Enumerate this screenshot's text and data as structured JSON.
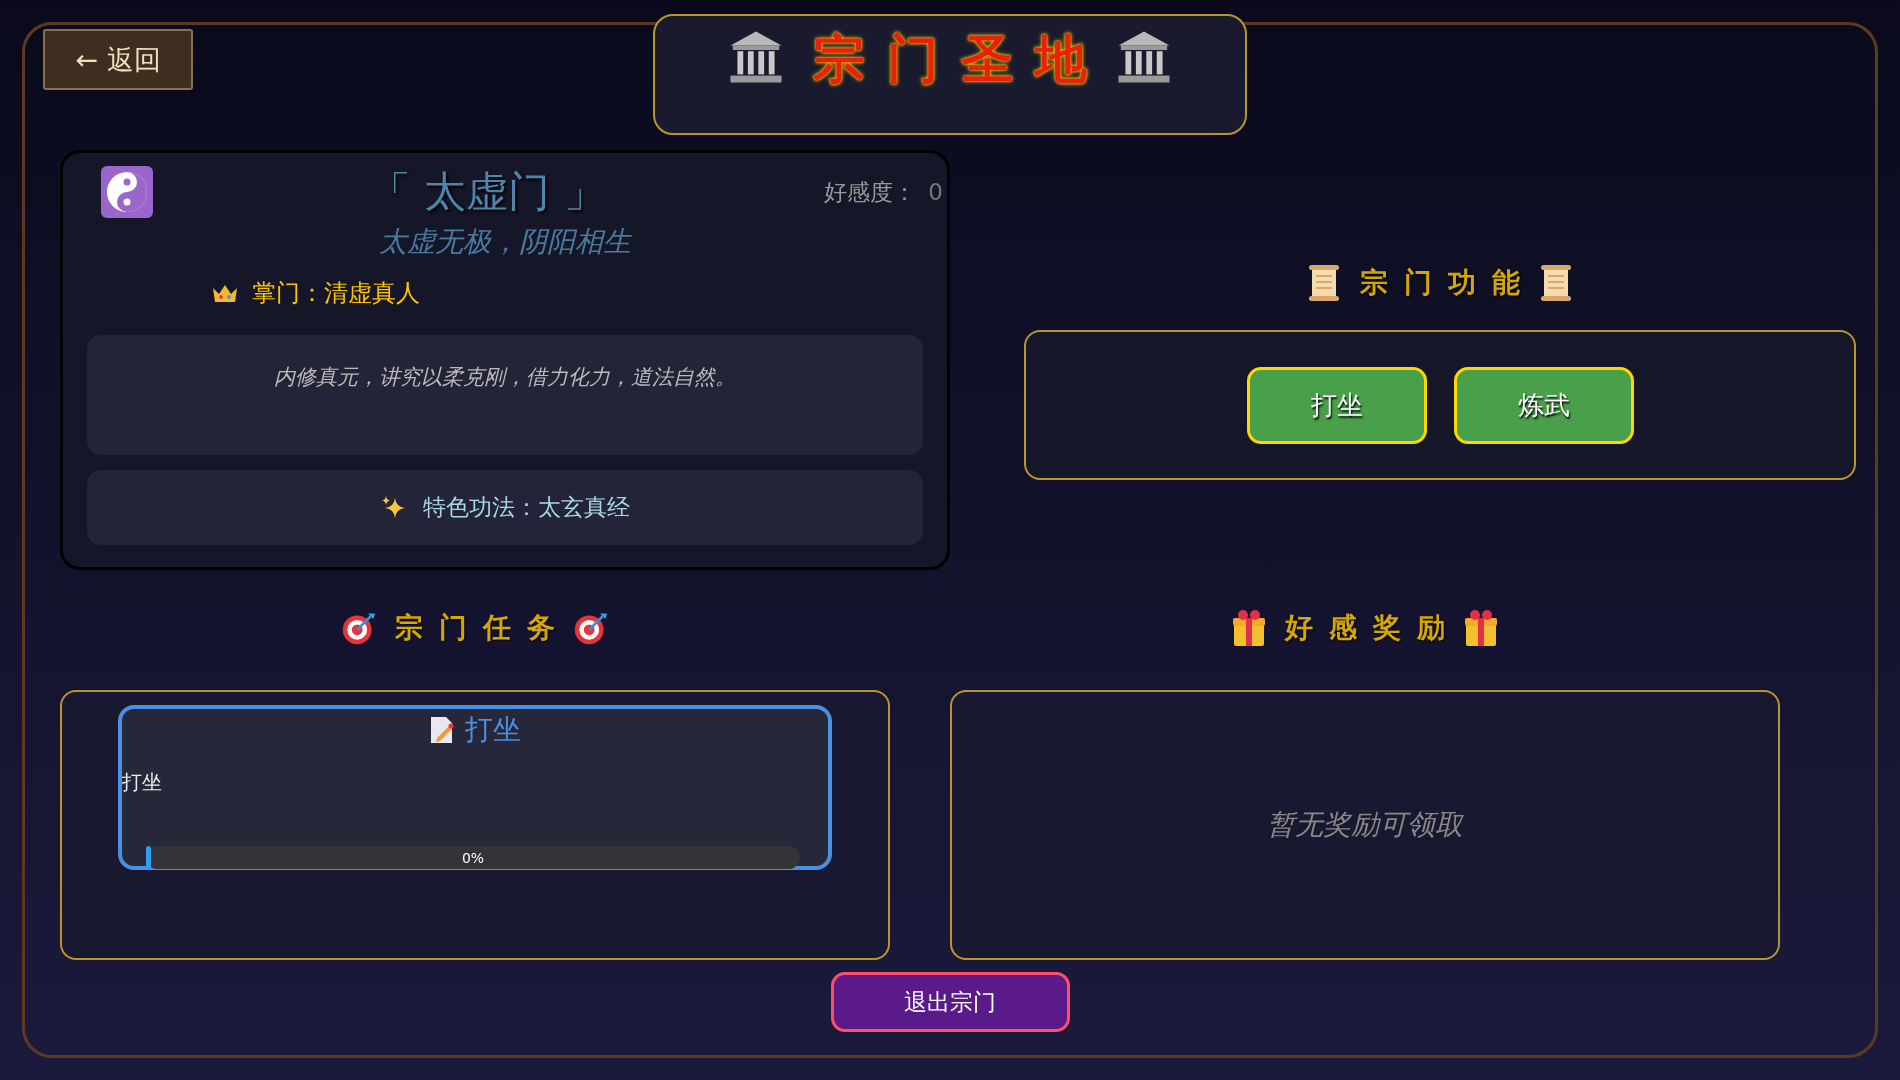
{
  "back_button": {
    "label": "← 返回"
  },
  "title": "宗门圣地",
  "sect": {
    "name": "「 太虚门 」",
    "favor_label": "好感度：",
    "favor_value": "0",
    "motto": "太虚无极，阴阳相生",
    "leader": "掌门：清虚真人",
    "description": "内修真元，讲究以柔克刚，借力化力，道法自然。",
    "technique": "特色功法：太玄真经"
  },
  "functions": {
    "title": "宗门功能",
    "buttons": [
      "打坐",
      "炼武"
    ]
  },
  "tasks": {
    "title": "宗门任务",
    "items": [
      {
        "title": "打坐",
        "description": "打坐",
        "level": 0,
        "progress": "0%"
      }
    ]
  },
  "rewards": {
    "title": "好感奖励",
    "empty_text": "暂无奖励可领取"
  },
  "exit_button": {
    "label": "退出宗门"
  }
}
